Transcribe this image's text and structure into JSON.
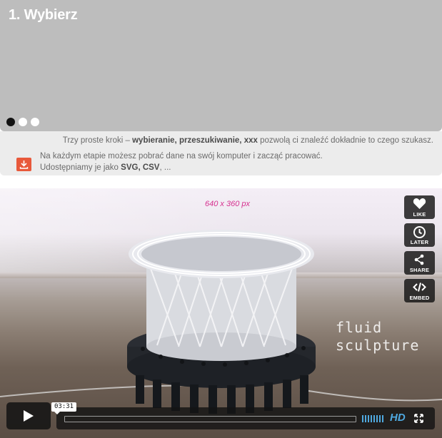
{
  "carousel": {
    "title": "1. Wybierz",
    "dots": [
      true,
      false,
      false
    ]
  },
  "info": {
    "steps": {
      "prefix": "Trzy proste kroki – ",
      "bold": "wybieranie, przeszukiwanie, xxx",
      "suffix": " pozwolą ci znaleźć dokładnie to czego szukasz."
    },
    "download": {
      "icon": "download-icon",
      "line1": "Na każdym etapie możesz pobrać dane na swój komputer i zacząć pracować.",
      "line2_prefix": "Udostępniamy je jako ",
      "line2_bold": "SVG, CSV",
      "line2_suffix": ", ...",
      "accent": "#e8593b"
    }
  },
  "video": {
    "resolution_label": "640 x 360 px",
    "watermark_line1": "fluid",
    "watermark_line2": "sculpture",
    "side_buttons": [
      {
        "label": "LIKE",
        "icon": "heart-icon"
      },
      {
        "label": "LATER",
        "icon": "clock-icon"
      },
      {
        "label": "SHARE",
        "icon": "share-icon"
      },
      {
        "label": "EMBED",
        "icon": "code-icon"
      }
    ],
    "time": "03:31",
    "progress": 0,
    "hd_label": "HD",
    "hd_color": "#4fa9e0"
  }
}
